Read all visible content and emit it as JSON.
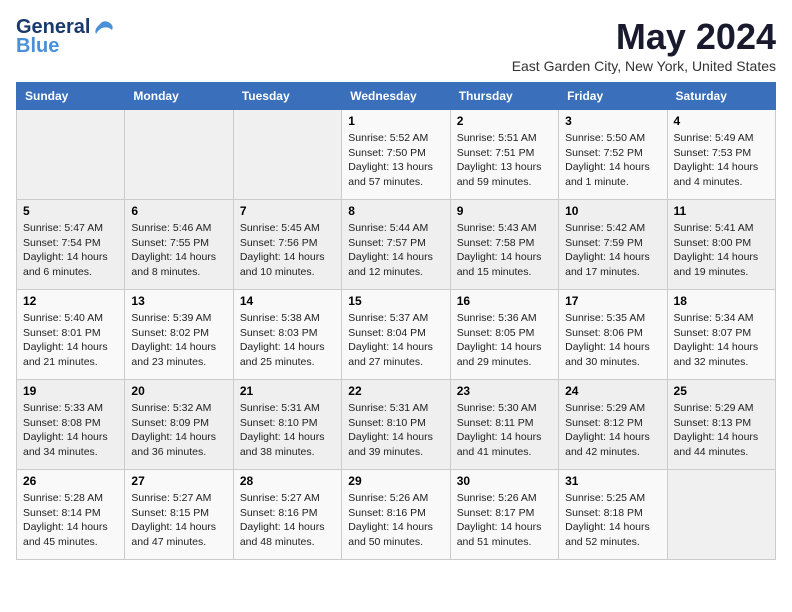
{
  "header": {
    "logo_general": "General",
    "logo_blue": "Blue",
    "month": "May 2024",
    "location": "East Garden City, New York, United States"
  },
  "weekdays": [
    "Sunday",
    "Monday",
    "Tuesday",
    "Wednesday",
    "Thursday",
    "Friday",
    "Saturday"
  ],
  "weeks": [
    [
      {
        "day": "",
        "info": ""
      },
      {
        "day": "",
        "info": ""
      },
      {
        "day": "",
        "info": ""
      },
      {
        "day": "1",
        "info": "Sunrise: 5:52 AM\nSunset: 7:50 PM\nDaylight: 13 hours and 57 minutes."
      },
      {
        "day": "2",
        "info": "Sunrise: 5:51 AM\nSunset: 7:51 PM\nDaylight: 13 hours and 59 minutes."
      },
      {
        "day": "3",
        "info": "Sunrise: 5:50 AM\nSunset: 7:52 PM\nDaylight: 14 hours and 1 minute."
      },
      {
        "day": "4",
        "info": "Sunrise: 5:49 AM\nSunset: 7:53 PM\nDaylight: 14 hours and 4 minutes."
      }
    ],
    [
      {
        "day": "5",
        "info": "Sunrise: 5:47 AM\nSunset: 7:54 PM\nDaylight: 14 hours and 6 minutes."
      },
      {
        "day": "6",
        "info": "Sunrise: 5:46 AM\nSunset: 7:55 PM\nDaylight: 14 hours and 8 minutes."
      },
      {
        "day": "7",
        "info": "Sunrise: 5:45 AM\nSunset: 7:56 PM\nDaylight: 14 hours and 10 minutes."
      },
      {
        "day": "8",
        "info": "Sunrise: 5:44 AM\nSunset: 7:57 PM\nDaylight: 14 hours and 12 minutes."
      },
      {
        "day": "9",
        "info": "Sunrise: 5:43 AM\nSunset: 7:58 PM\nDaylight: 14 hours and 15 minutes."
      },
      {
        "day": "10",
        "info": "Sunrise: 5:42 AM\nSunset: 7:59 PM\nDaylight: 14 hours and 17 minutes."
      },
      {
        "day": "11",
        "info": "Sunrise: 5:41 AM\nSunset: 8:00 PM\nDaylight: 14 hours and 19 minutes."
      }
    ],
    [
      {
        "day": "12",
        "info": "Sunrise: 5:40 AM\nSunset: 8:01 PM\nDaylight: 14 hours and 21 minutes."
      },
      {
        "day": "13",
        "info": "Sunrise: 5:39 AM\nSunset: 8:02 PM\nDaylight: 14 hours and 23 minutes."
      },
      {
        "day": "14",
        "info": "Sunrise: 5:38 AM\nSunset: 8:03 PM\nDaylight: 14 hours and 25 minutes."
      },
      {
        "day": "15",
        "info": "Sunrise: 5:37 AM\nSunset: 8:04 PM\nDaylight: 14 hours and 27 minutes."
      },
      {
        "day": "16",
        "info": "Sunrise: 5:36 AM\nSunset: 8:05 PM\nDaylight: 14 hours and 29 minutes."
      },
      {
        "day": "17",
        "info": "Sunrise: 5:35 AM\nSunset: 8:06 PM\nDaylight: 14 hours and 30 minutes."
      },
      {
        "day": "18",
        "info": "Sunrise: 5:34 AM\nSunset: 8:07 PM\nDaylight: 14 hours and 32 minutes."
      }
    ],
    [
      {
        "day": "19",
        "info": "Sunrise: 5:33 AM\nSunset: 8:08 PM\nDaylight: 14 hours and 34 minutes."
      },
      {
        "day": "20",
        "info": "Sunrise: 5:32 AM\nSunset: 8:09 PM\nDaylight: 14 hours and 36 minutes."
      },
      {
        "day": "21",
        "info": "Sunrise: 5:31 AM\nSunset: 8:10 PM\nDaylight: 14 hours and 38 minutes."
      },
      {
        "day": "22",
        "info": "Sunrise: 5:31 AM\nSunset: 8:10 PM\nDaylight: 14 hours and 39 minutes."
      },
      {
        "day": "23",
        "info": "Sunrise: 5:30 AM\nSunset: 8:11 PM\nDaylight: 14 hours and 41 minutes."
      },
      {
        "day": "24",
        "info": "Sunrise: 5:29 AM\nSunset: 8:12 PM\nDaylight: 14 hours and 42 minutes."
      },
      {
        "day": "25",
        "info": "Sunrise: 5:29 AM\nSunset: 8:13 PM\nDaylight: 14 hours and 44 minutes."
      }
    ],
    [
      {
        "day": "26",
        "info": "Sunrise: 5:28 AM\nSunset: 8:14 PM\nDaylight: 14 hours and 45 minutes."
      },
      {
        "day": "27",
        "info": "Sunrise: 5:27 AM\nSunset: 8:15 PM\nDaylight: 14 hours and 47 minutes."
      },
      {
        "day": "28",
        "info": "Sunrise: 5:27 AM\nSunset: 8:16 PM\nDaylight: 14 hours and 48 minutes."
      },
      {
        "day": "29",
        "info": "Sunrise: 5:26 AM\nSunset: 8:16 PM\nDaylight: 14 hours and 50 minutes."
      },
      {
        "day": "30",
        "info": "Sunrise: 5:26 AM\nSunset: 8:17 PM\nDaylight: 14 hours and 51 minutes."
      },
      {
        "day": "31",
        "info": "Sunrise: 5:25 AM\nSunset: 8:18 PM\nDaylight: 14 hours and 52 minutes."
      },
      {
        "day": "",
        "info": ""
      }
    ]
  ]
}
